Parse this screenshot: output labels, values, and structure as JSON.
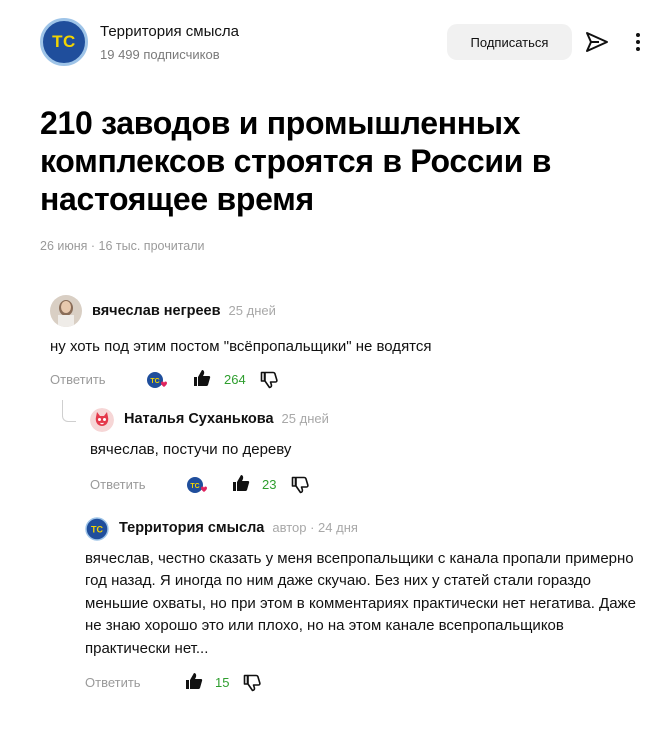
{
  "channel": {
    "avatar_initials": "TC",
    "name": "Территория смысла",
    "subscribers": "19 499 подписчиков",
    "subscribe_label": "Подписаться"
  },
  "article": {
    "title": "210 заводов и промышленных комплексов строятся в России в настоящее время",
    "meta": "26 июня · 16 тыс. прочитали"
  },
  "comments": [
    {
      "author": "вячеслав негреев",
      "time": "25 дней",
      "text": "ну хоть под этим постом \"всёпропальщики\" не водятся",
      "reply_label": "Ответить",
      "likes": "264",
      "has_author_reaction": true
    },
    {
      "author": "Наталья Суханькова",
      "time": "25 дней",
      "text": "вячеслав, постучи по дереву",
      "reply_label": "Ответить",
      "likes": "23",
      "has_author_reaction": true
    },
    {
      "author": "Территория смысла",
      "avatar_initials": "TC",
      "time": "автор · 24 дня",
      "text": "вячеслав, честно сказать у меня всепропальщики с канала пропали примерно год назад. Я иногда по ним даже скучаю. Без них у статей стали гораздо меньшие охваты, но при этом в комментариях практически нет негатива. Даже не знаю хорошо это или плохо, но на этом канале всепропальщиков практически нет...",
      "reply_label": "Ответить",
      "likes": "15",
      "has_author_reaction": false
    }
  ],
  "colors": {
    "like_count": "#2e9e2e",
    "channel_avatar_bg": "#1f4e9c",
    "channel_avatar_text": "#f2d400",
    "muted_text": "#9a9a9a"
  },
  "icons": [
    "send-icon",
    "more-vertical-icon",
    "thumbs-up-icon",
    "thumbs-down-icon",
    "heart-icon"
  ]
}
